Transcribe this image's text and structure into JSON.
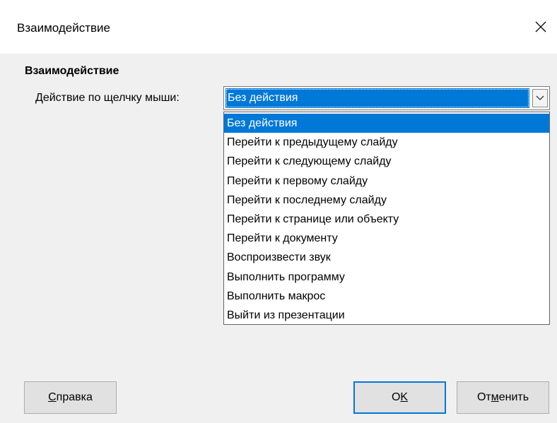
{
  "window": {
    "title": "Взаимодействие"
  },
  "section": {
    "title": "Взаимодействие"
  },
  "action": {
    "label_first_char": "Д",
    "label_rest": "ействие по щелчку мыши:",
    "selected_value": "Без действия",
    "options": [
      "Без действия",
      "Перейти к предыдущему слайду",
      "Перейти к следующему слайду",
      "Перейти к первому слайду",
      "Перейти к последнему слайду",
      "Перейти к странице или объекту",
      "Перейти к документу",
      "Воспроизвести звук",
      "Выполнить программу",
      "Выполнить макрос",
      "Выйти из презентации"
    ],
    "highlighted_index": 0
  },
  "buttons": {
    "help_first_char": "С",
    "help_rest": "правка",
    "ok_first": "O",
    "ok_underlined": "K",
    "cancel_first": "От",
    "cancel_underlined": "м",
    "cancel_rest": "енить"
  },
  "colors": {
    "accent": "#0078d7",
    "background": "#f0f0f0",
    "titlebar": "#ffffff"
  },
  "icons": {
    "close": "close-icon",
    "dropdown": "chevron-down-icon"
  }
}
